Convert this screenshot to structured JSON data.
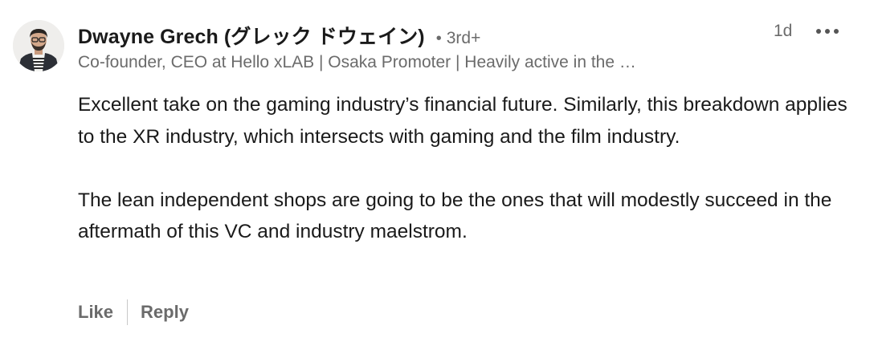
{
  "comment": {
    "author": {
      "name": "Dwayne Grech (グレック ドウェイン)",
      "degree_separator": "•",
      "degree": "3rd+",
      "headline": "Co-founder, CEO at Hello xLAB | Osaka Promoter | Heavily active in the …",
      "avatar_icon": "person-avatar-icon"
    },
    "timestamp": "1d",
    "more_icon": "more-options-icon",
    "body": {
      "paragraphs": [
        "Excellent take on the gaming industry’s financial future. Similarly, this breakdown applies to the XR industry, which intersects with gaming and the film industry.",
        "The lean independent shops are going to be the ones that will modestly succeed in the aftermath of this VC and industry maelstrom."
      ]
    },
    "actions": {
      "like_label": "Like",
      "reply_label": "Reply"
    }
  },
  "colors": {
    "primary_text": "#1a1a1a",
    "secondary_text": "#6b6b6b",
    "divider": "#c8c8c8",
    "background": "#ffffff"
  }
}
